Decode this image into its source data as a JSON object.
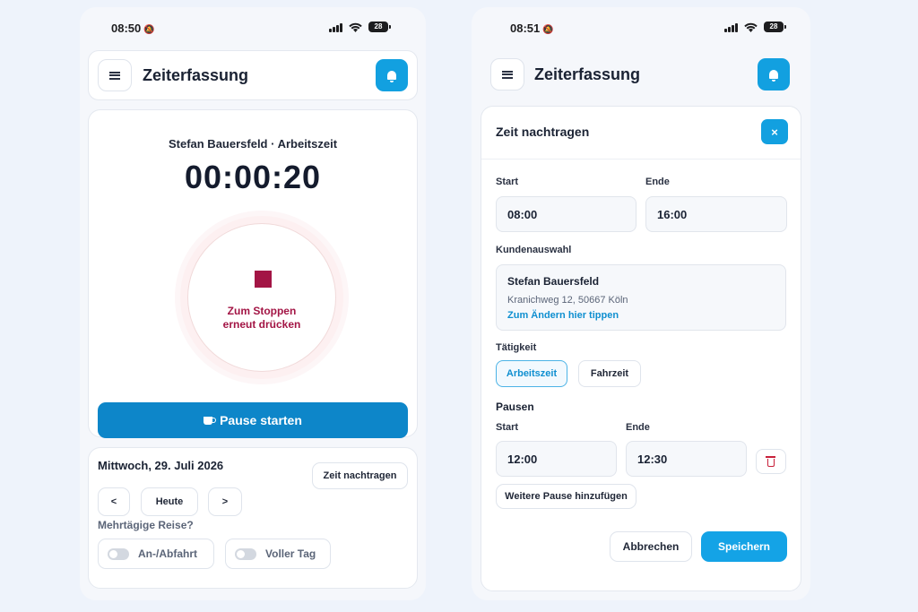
{
  "left": {
    "status": {
      "time": "08:50",
      "battery": "28"
    },
    "appbar": {
      "title": "Zeiterfassung"
    },
    "timer": {
      "name": "Stefan Bauersfeld · Arbeitszeit",
      "value": "00:00:20",
      "stop_line1": "Zum Stoppen",
      "stop_line2": "erneut drücken",
      "pause_label": "Pause starten"
    },
    "date_card": {
      "date": "Mittwoch, 29. Juli 2026",
      "add_time_label": "Zeit nachtragen",
      "prev_label": "<",
      "today_label": "Heute",
      "next_label": ">",
      "multi_day_label": "Mehrtägige Reise?",
      "toggle_arrival": "An-/Abfahrt",
      "toggle_fullday": "Voller Tag"
    }
  },
  "right": {
    "status": {
      "time": "08:51",
      "battery": "28"
    },
    "appbar": {
      "title": "Zeiterfassung"
    },
    "modal": {
      "title": "Zeit nachtragen",
      "close": "×",
      "start_label": "Start",
      "start_value": "08:00",
      "end_label": "Ende",
      "end_value": "16:00",
      "customer_label": "Kundenauswahl",
      "customer_name": "Stefan Bauersfeld",
      "customer_address": "Kranichweg 12, 50667 Köln",
      "customer_change": "Zum Ändern hier tippen",
      "activity_label": "Tätigkeit",
      "activity_work": "Arbeitszeit",
      "activity_travel": "Fahrzeit",
      "breaks_title": "Pausen",
      "break_start_label": "Start",
      "break_start_value": "12:00",
      "break_end_label": "Ende",
      "break_end_value": "12:30",
      "add_break_label": "Weitere Pause hinzufügen",
      "cancel_label": "Abbrechen",
      "save_label": "Speichern"
    }
  },
  "colors": {
    "accent": "#12a0e0",
    "primary_button": "#0d86c9",
    "stop": "#a31545",
    "delete": "#c8203a"
  }
}
